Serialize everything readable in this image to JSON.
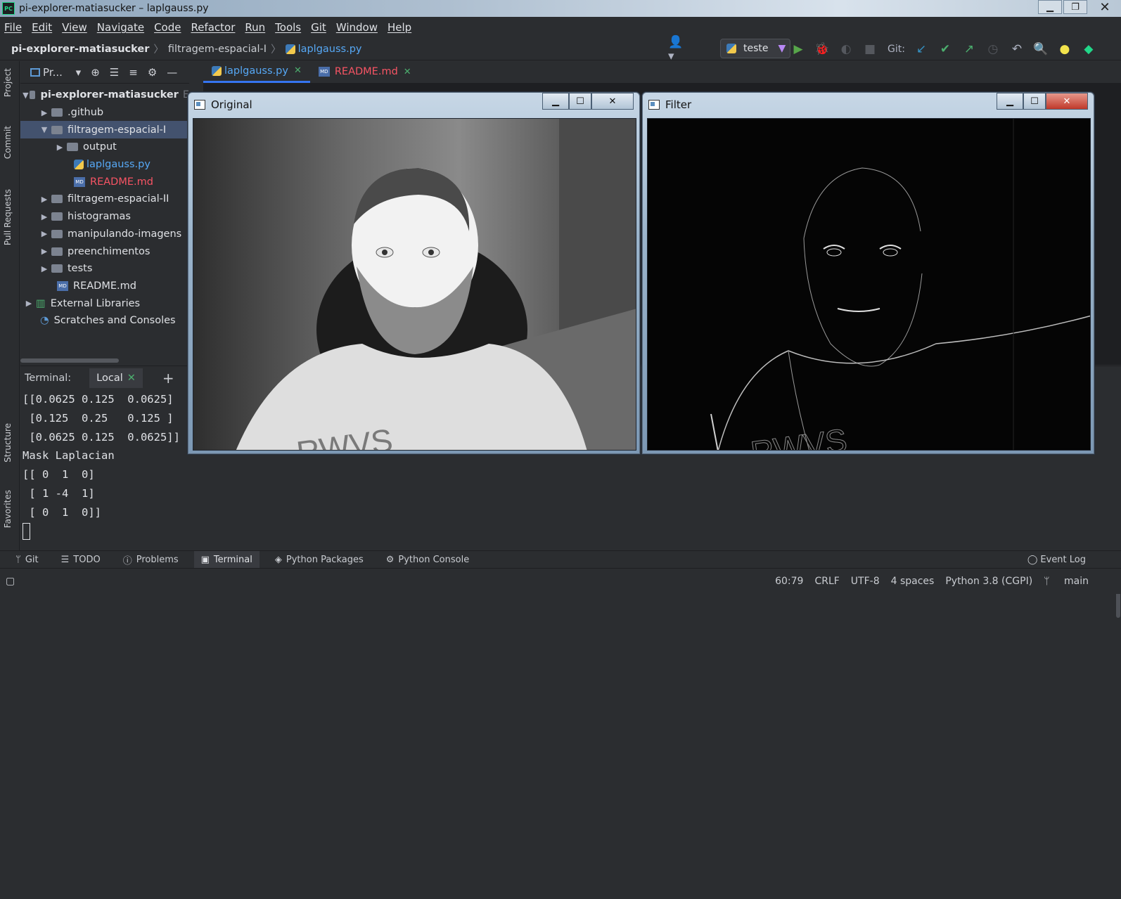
{
  "window": {
    "title": "pi-explorer-matiasucker – laplgauss.py",
    "app_icon": "PC"
  },
  "menu": [
    "File",
    "Edit",
    "View",
    "Navigate",
    "Code",
    "Refactor",
    "Run",
    "Tools",
    "Git",
    "Window",
    "Help"
  ],
  "breadcrumb": {
    "project": "pi-explorer-matiasucker",
    "folder": "filtragem-espacial-I",
    "file": "laplgauss.py"
  },
  "toolbar": {
    "run_config": "teste",
    "git_label": "Git:"
  },
  "project_panel": {
    "title": "Pr...",
    "root": "pi-explorer-matiasucker",
    "root_hint": "E",
    "items": [
      {
        "label": ".github",
        "type": "folder",
        "level": 1,
        "expanded": false
      },
      {
        "label": "filtragem-espacial-I",
        "type": "folder",
        "level": 1,
        "expanded": true,
        "selected": true
      },
      {
        "label": "output",
        "type": "folder",
        "level": 2,
        "expanded": false
      },
      {
        "label": "laplgauss.py",
        "type": "py",
        "level": 2
      },
      {
        "label": "README.md",
        "type": "md-red",
        "level": 2
      },
      {
        "label": "filtragem-espacial-II",
        "type": "folder",
        "level": 1,
        "expanded": false
      },
      {
        "label": "histogramas",
        "type": "folder",
        "level": 1,
        "expanded": false
      },
      {
        "label": "manipulando-imagens",
        "type": "folder",
        "level": 1,
        "expanded": false
      },
      {
        "label": "preenchimentos",
        "type": "folder",
        "level": 1,
        "expanded": false
      },
      {
        "label": "tests",
        "type": "folder",
        "level": 1,
        "expanded": false
      },
      {
        "label": "README.md",
        "type": "md",
        "level": 1
      },
      {
        "label": "External Libraries",
        "type": "lib",
        "level": 0
      },
      {
        "label": "Scratches and Consoles",
        "type": "scratch",
        "level": 0
      }
    ]
  },
  "editor_tabs": [
    {
      "label": "laplgauss.py",
      "active": true
    },
    {
      "label": "README.md",
      "active": false
    }
  ],
  "left_strip": [
    "Project",
    "Commit",
    "Pull Requests",
    "Structure",
    "Favorites"
  ],
  "terminal": {
    "title": "Terminal:",
    "tab": "Local",
    "lines": [
      "[[0.0625 0.125  0.0625]",
      " [0.125  0.25   0.125 ]",
      " [0.0625 0.125  0.0625]]",
      "Mask Laplacian",
      "[[ 0  1  0]",
      " [ 1 -4  1]",
      " [ 0  1  0]]"
    ]
  },
  "cv_windows": [
    {
      "title": "Original"
    },
    {
      "title": "Filter"
    }
  ],
  "shirt_text": "RWVS",
  "bottom_tabs": [
    "Git",
    "TODO",
    "Problems",
    "Terminal",
    "Python Packages",
    "Python Console"
  ],
  "event_log": "Event Log",
  "status": {
    "position": "60:79",
    "line_sep": "CRLF",
    "encoding": "UTF-8",
    "indent": "4 spaces",
    "interpreter": "Python 3.8 (CGPI)",
    "branch": "main"
  }
}
